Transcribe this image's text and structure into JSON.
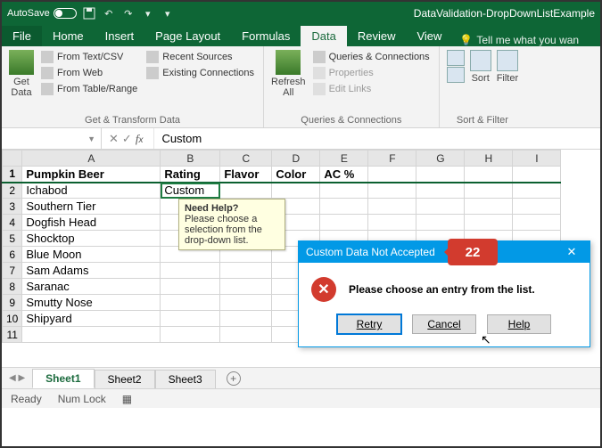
{
  "titlebar": {
    "autosave_label": "AutoSave",
    "autosave_state": "On",
    "doc_title": "DataValidation-DropDownListExample"
  },
  "tabs": {
    "file": "File",
    "items": [
      "Home",
      "Insert",
      "Page Layout",
      "Formulas",
      "Data",
      "Review",
      "View"
    ],
    "active": "Data",
    "tellme": "Tell me what you wan"
  },
  "ribbon": {
    "get_data": "Get\nData",
    "from_text": "From Text/CSV",
    "from_web": "From Web",
    "from_table": "From Table/Range",
    "recent": "Recent Sources",
    "existing": "Existing Connections",
    "group1": "Get & Transform Data",
    "refresh": "Refresh\nAll",
    "queries": "Queries & Connections",
    "properties": "Properties",
    "edit_links": "Edit Links",
    "group2": "Queries & Connections",
    "sort": "Sort",
    "filter": "Filter",
    "group3": "Sort & Filter"
  },
  "fbar": {
    "namebox": "",
    "formula": "Custom"
  },
  "sheet": {
    "cols": [
      "A",
      "B",
      "C",
      "D",
      "E",
      "F",
      "G",
      "H",
      "I"
    ],
    "rows": [
      {
        "n": "1",
        "A": "Pumpkin Beer",
        "B": "Rating",
        "C": "Flavor",
        "D": "Color",
        "E": "AC %",
        "hdr": true
      },
      {
        "n": "2",
        "A": "Ichabod",
        "B": "Custom",
        "sel": true
      },
      {
        "n": "3",
        "A": "Southern Tier"
      },
      {
        "n": "4",
        "A": "Dogfish Head"
      },
      {
        "n": "5",
        "A": "Shocktop"
      },
      {
        "n": "6",
        "A": "Blue Moon"
      },
      {
        "n": "7",
        "A": "Sam Adams"
      },
      {
        "n": "8",
        "A": "Saranac"
      },
      {
        "n": "9",
        "A": "Smutty Nose"
      },
      {
        "n": "10",
        "A": "Shipyard"
      },
      {
        "n": "11"
      }
    ]
  },
  "input_message": {
    "title": "Need Help?",
    "body": "Please choose a selection from the drop-down list."
  },
  "dialog": {
    "title": "Custom Data Not Accepted",
    "body": "Please choose an entry from the list.",
    "retry": "Retry",
    "cancel": "Cancel",
    "help": "Help"
  },
  "badge": "22",
  "sheettabs": {
    "items": [
      "Sheet1",
      "Sheet2",
      "Sheet3"
    ],
    "active": "Sheet1"
  },
  "status": {
    "ready": "Ready",
    "numlock": "Num Lock"
  }
}
